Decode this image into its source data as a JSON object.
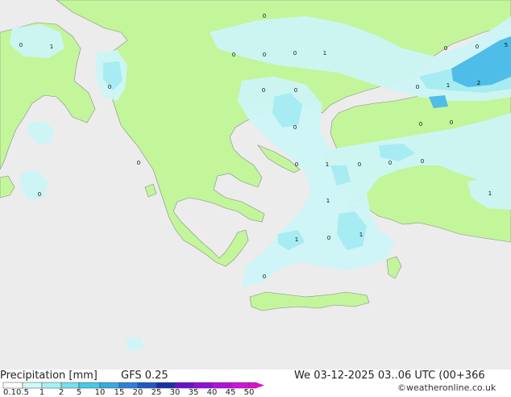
{
  "footer": {
    "title": "Precipitation [mm]",
    "model": "GFS 0.25",
    "datetime": "We 03-12-2025 03..06 UTC (00+366",
    "credit": "©weatheronline.co.uk"
  },
  "legend": {
    "labels": [
      "0.1",
      "0.5",
      "1",
      "2",
      "5",
      "10",
      "15",
      "20",
      "25",
      "30",
      "35",
      "40",
      "45",
      "50"
    ],
    "colors": [
      "#ffffff",
      "#d2f8f8",
      "#a8f0f4",
      "#76e0ee",
      "#48c8e8",
      "#3aa8e0",
      "#2a80d8",
      "#2058c8",
      "#1830a8",
      "#6a10c8",
      "#9010d8",
      "#b010e0",
      "#d010e0",
      "#e010c8"
    ]
  },
  "map": {
    "colors": {
      "sea": "#ececec",
      "land": "#c3f59b",
      "precip_light": "#cdf5f7",
      "precip_mid": "#a6ecf2",
      "precip_heavy": "#4ebde8"
    },
    "amount_labels": [
      "0",
      "0",
      "0",
      "0",
      "0",
      "1",
      "0",
      "0",
      "0",
      "1",
      "0",
      "0",
      "0",
      "1",
      "0",
      "0",
      "0",
      "0",
      "0",
      "1",
      "0",
      "0",
      "0",
      "1",
      "1",
      "1",
      "0",
      "0",
      "2",
      "1",
      "5",
      "0"
    ]
  }
}
